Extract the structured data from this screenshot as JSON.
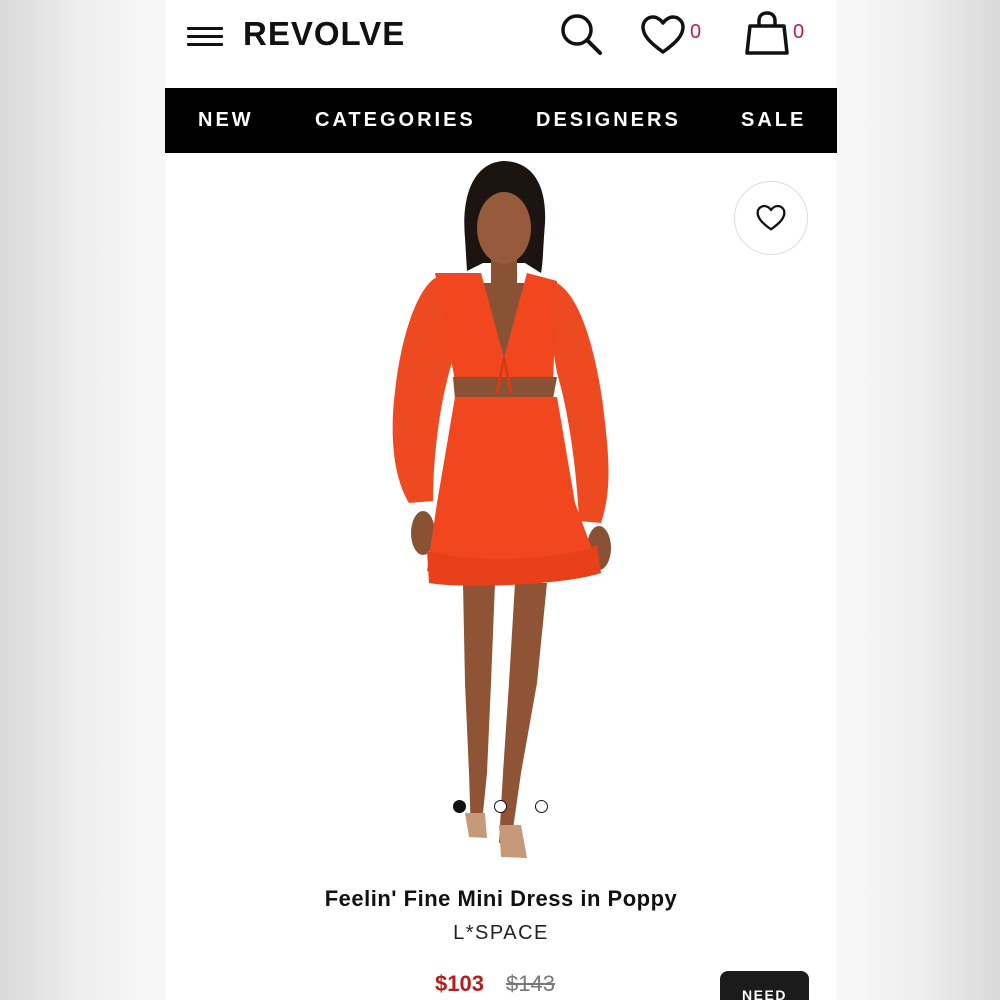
{
  "header": {
    "logo": "REVOLVE",
    "wishlist_count": "0",
    "bag_count": "0",
    "icons": [
      "hamburger-menu-icon",
      "search-icon",
      "heart-icon",
      "shopping-bag-icon"
    ]
  },
  "nav": {
    "items": [
      {
        "label": "NEW"
      },
      {
        "label": "CATEGORIES"
      },
      {
        "label": "DESIGNERS"
      },
      {
        "label": "SALE"
      }
    ]
  },
  "gallery": {
    "slide_count": 3,
    "active_slide": 1
  },
  "product": {
    "title": "Feelin' Fine Mini Dress in Poppy",
    "brand": "L*SPACE",
    "price": "$103",
    "original_price": "$143",
    "action_label": "NEED"
  },
  "colors": {
    "nav_background": "#000000",
    "count_accent": "#c2185b",
    "sale_price": "#b71c1c",
    "dress": "#f2461e"
  }
}
